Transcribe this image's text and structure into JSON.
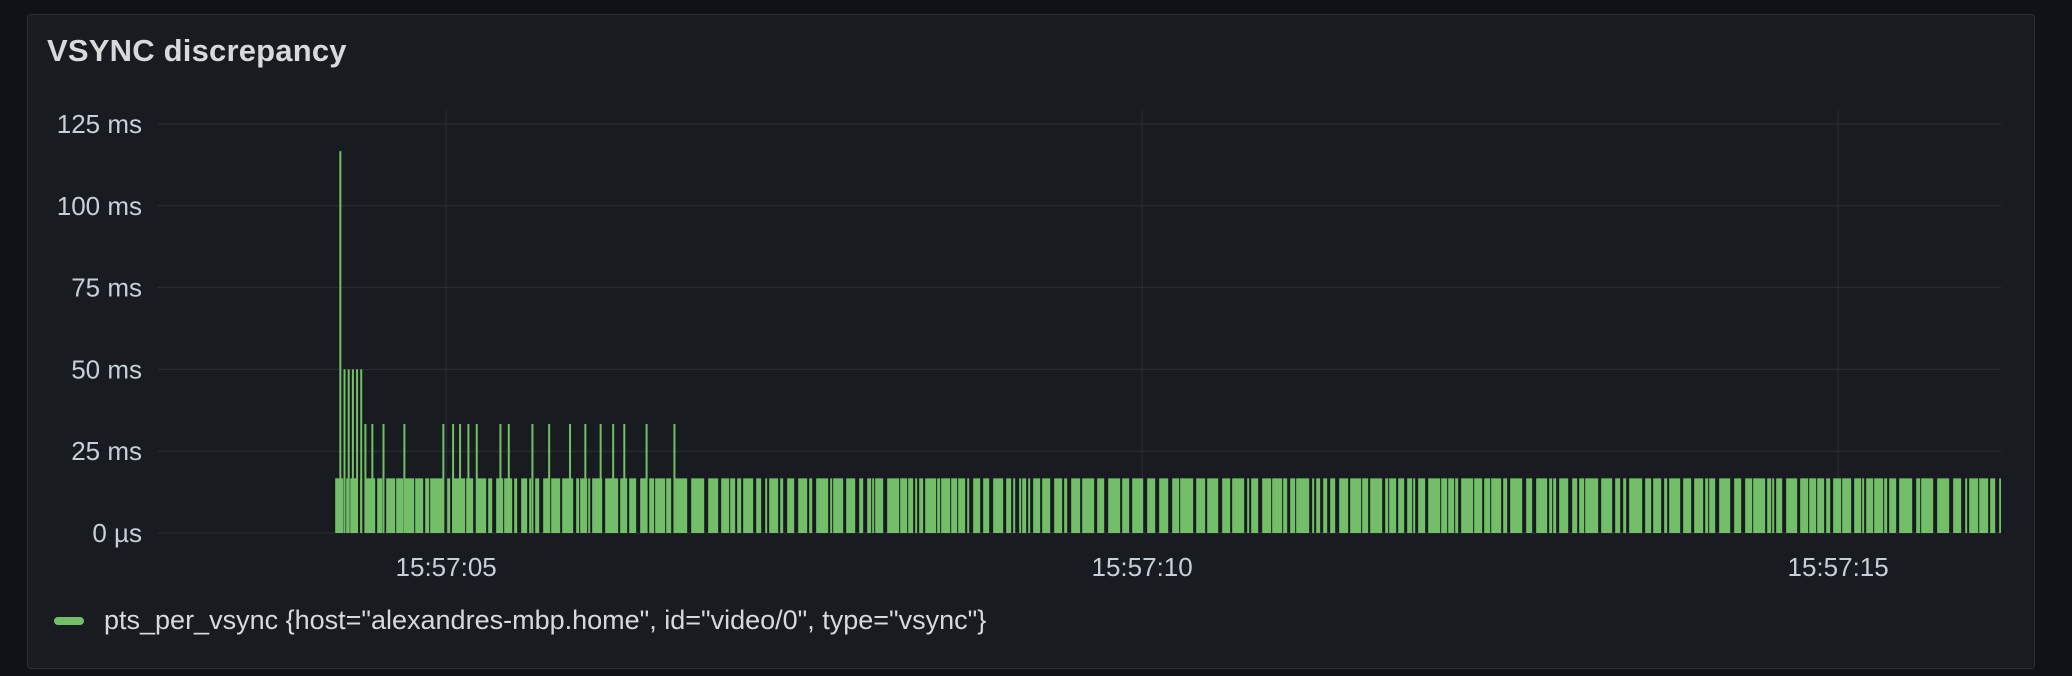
{
  "panel": {
    "title": "VSYNC discrepancy"
  },
  "chart_data": {
    "type": "bar",
    "title": "VSYNC discrepancy",
    "xlabel": "",
    "ylabel": "",
    "y_unit": "ms",
    "y_ticks": [
      "0 µs",
      "25 ms",
      "50 ms",
      "75 ms",
      "100 ms",
      "125 ms"
    ],
    "y_tick_values": [
      0,
      25,
      50,
      75,
      100,
      125
    ],
    "ylim": [
      0,
      125
    ],
    "x_ticks": [
      "15:57:05",
      "15:57:10",
      "15:57:15"
    ],
    "x_tick_values": [
      5,
      10,
      15
    ],
    "xlim": [
      2.93,
      16.17
    ],
    "x_unit": "seconds after 15:57:00",
    "grid": true,
    "legend_position": "bottom-left",
    "color": "#73bf69",
    "series": [
      {
        "name": "pts_per_vsync {host=\"alexandres-mbp.home\", id=\"video/0\", type=\"vsync\"}",
        "spikes": [
          {
            "x": 4.21,
            "value": 16.7
          },
          {
            "x": 4.24,
            "value": 116.7
          },
          {
            "x": 4.27,
            "value": 50
          },
          {
            "x": 4.3,
            "value": 50
          },
          {
            "x": 4.33,
            "value": 50
          },
          {
            "x": 4.36,
            "value": 50
          },
          {
            "x": 4.39,
            "value": 50
          },
          {
            "x": 4.42,
            "value": 33.3
          },
          {
            "x": 4.47,
            "value": 33.3
          },
          {
            "x": 4.55,
            "value": 33.3
          },
          {
            "x": 4.7,
            "value": 33.3
          },
          {
            "x": 4.98,
            "value": 33.3
          },
          {
            "x": 5.05,
            "value": 33.3
          },
          {
            "x": 5.1,
            "value": 33.3
          },
          {
            "x": 5.16,
            "value": 33.3
          },
          {
            "x": 5.22,
            "value": 33.3
          },
          {
            "x": 5.39,
            "value": 33.3
          },
          {
            "x": 5.45,
            "value": 33.3
          },
          {
            "x": 5.62,
            "value": 33.3
          },
          {
            "x": 5.74,
            "value": 33.3
          },
          {
            "x": 5.89,
            "value": 33.3
          },
          {
            "x": 6.0,
            "value": 33.3
          },
          {
            "x": 6.11,
            "value": 33.3
          },
          {
            "x": 6.2,
            "value": 33.3
          },
          {
            "x": 6.28,
            "value": 33.3
          },
          {
            "x": 6.44,
            "value": 33.3
          },
          {
            "x": 6.64,
            "value": 33.3
          }
        ],
        "baseline_value": 16.7,
        "baseline_range": [
          4.21,
          16.17
        ]
      }
    ]
  }
}
